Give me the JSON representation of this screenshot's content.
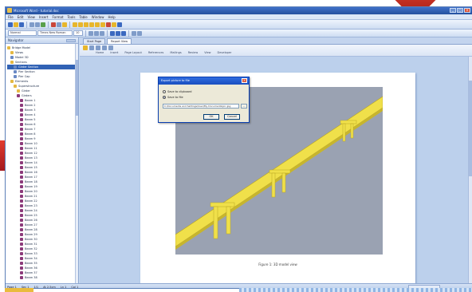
{
  "window": {
    "title": "Microsoft Word - tutorial.doc",
    "controls": [
      "_",
      "□",
      "×"
    ]
  },
  "menubar": {
    "items": [
      "File",
      "Edit",
      "View",
      "Insert",
      "Format",
      "Tools",
      "Table",
      "Window",
      "Help"
    ]
  },
  "toolbar": {
    "style_combo": "Normal",
    "font_combo": "Times New Roman",
    "size_combo": "10"
  },
  "navigator": {
    "title": "Navigator",
    "items": [
      {
        "label": "Bridge Model",
        "icon": "folder-icon",
        "kind": "folder"
      },
      {
        "label": "Views",
        "icon": "folder-icon",
        "kind": "folder"
      },
      {
        "label": "Model 3D",
        "icon": "doc-icon",
        "kind": "doc"
      },
      {
        "label": "Sections",
        "icon": "folder-icon",
        "kind": "folder"
      },
      {
        "label": "Girder Section",
        "icon": "doc-icon",
        "kind": "doc"
      },
      {
        "label": "Pier Section",
        "icon": "doc-icon",
        "kind": "doc"
      },
      {
        "label": "Pier Cap",
        "icon": "doc-icon",
        "kind": "doc"
      },
      {
        "label": "Elements",
        "icon": "folder-icon",
        "kind": "folder"
      },
      {
        "label": "Superstructure",
        "icon": "folder-icon",
        "kind": "folder"
      },
      {
        "label": "Girder",
        "icon": "folder-icon",
        "kind": "folder"
      },
      {
        "label": "Girders",
        "icon": "beam-icon",
        "kind": "beam"
      },
      {
        "label": "Beam 1",
        "icon": "beam-icon",
        "kind": "beam"
      },
      {
        "label": "Beam 2",
        "icon": "beam-icon",
        "kind": "beam"
      },
      {
        "label": "Beam 3",
        "icon": "beam-icon",
        "kind": "beam"
      },
      {
        "label": "Beam 4",
        "icon": "beam-icon",
        "kind": "beam"
      },
      {
        "label": "Beam 5",
        "icon": "beam-icon",
        "kind": "beam"
      },
      {
        "label": "Beam 6",
        "icon": "beam-icon",
        "kind": "beam"
      },
      {
        "label": "Beam 7",
        "icon": "beam-icon",
        "kind": "beam"
      },
      {
        "label": "Beam 8",
        "icon": "beam-icon",
        "kind": "beam"
      },
      {
        "label": "Beam 9",
        "icon": "beam-icon",
        "kind": "beam"
      },
      {
        "label": "Beam 10",
        "icon": "beam-icon",
        "kind": "beam"
      },
      {
        "label": "Beam 11",
        "icon": "beam-icon",
        "kind": "beam"
      },
      {
        "label": "Beam 12",
        "icon": "beam-icon",
        "kind": "beam"
      },
      {
        "label": "Beam 13",
        "icon": "beam-icon",
        "kind": "beam"
      },
      {
        "label": "Beam 14",
        "icon": "beam-icon",
        "kind": "beam"
      },
      {
        "label": "Beam 15",
        "icon": "beam-icon",
        "kind": "beam"
      },
      {
        "label": "Beam 16",
        "icon": "beam-icon",
        "kind": "beam"
      },
      {
        "label": "Beam 17",
        "icon": "beam-icon",
        "kind": "beam"
      },
      {
        "label": "Beam 18",
        "icon": "beam-icon",
        "kind": "beam"
      },
      {
        "label": "Beam 19",
        "icon": "beam-icon",
        "kind": "beam"
      },
      {
        "label": "Beam 20",
        "icon": "beam-icon",
        "kind": "beam"
      },
      {
        "label": "Beam 21",
        "icon": "beam-icon",
        "kind": "beam"
      },
      {
        "label": "Beam 22",
        "icon": "beam-icon",
        "kind": "beam"
      },
      {
        "label": "Beam 23",
        "icon": "beam-icon",
        "kind": "beam"
      },
      {
        "label": "Beam 24",
        "icon": "beam-icon",
        "kind": "beam"
      },
      {
        "label": "Beam 25",
        "icon": "beam-icon",
        "kind": "beam"
      },
      {
        "label": "Beam 26",
        "icon": "beam-icon",
        "kind": "beam"
      },
      {
        "label": "Beam 27",
        "icon": "beam-icon",
        "kind": "beam"
      },
      {
        "label": "Beam 28",
        "icon": "beam-icon",
        "kind": "beam"
      },
      {
        "label": "Beam 29",
        "icon": "beam-icon",
        "kind": "beam"
      },
      {
        "label": "Beam 30",
        "icon": "beam-icon",
        "kind": "beam"
      },
      {
        "label": "Beam 31",
        "icon": "beam-icon",
        "kind": "beam"
      },
      {
        "label": "Beam 32",
        "icon": "beam-icon",
        "kind": "beam"
      },
      {
        "label": "Beam 33",
        "icon": "beam-icon",
        "kind": "beam"
      },
      {
        "label": "Beam 34",
        "icon": "beam-icon",
        "kind": "beam"
      },
      {
        "label": "Beam 35",
        "icon": "beam-icon",
        "kind": "beam"
      },
      {
        "label": "Beam 36",
        "icon": "beam-icon",
        "kind": "beam"
      },
      {
        "label": "Beam 37",
        "icon": "beam-icon",
        "kind": "beam"
      },
      {
        "label": "Beam 38",
        "icon": "beam-icon",
        "kind": "beam"
      }
    ]
  },
  "document": {
    "tabs": [
      "Start Page",
      "Report View"
    ],
    "subtoolbar": [
      "Home",
      "Insert",
      "Page Layout",
      "References",
      "Mailings",
      "Review",
      "View",
      "Developer"
    ],
    "caption": "Figure 1: 3D model view"
  },
  "dialog": {
    "title": "Export picture to file",
    "options": [
      "Save to clipboard",
      "Save to file"
    ],
    "selected_option": 1,
    "path": "C:\\Documents and Settings\\User\\My Documents\\pic.jpg",
    "browse": "...",
    "ok": "OK",
    "cancel": "Cancel"
  },
  "statusbar": {
    "items": [
      "Page 1",
      "Sec 1",
      "1/1",
      "At 2.5cm",
      "Ln 1",
      "Col 1"
    ]
  },
  "colors": {
    "titlebar": "#2c5db2",
    "bridge": "#f0e04a",
    "viewport_bg": "#9aa2b2",
    "decoration_red": "#d43226"
  }
}
